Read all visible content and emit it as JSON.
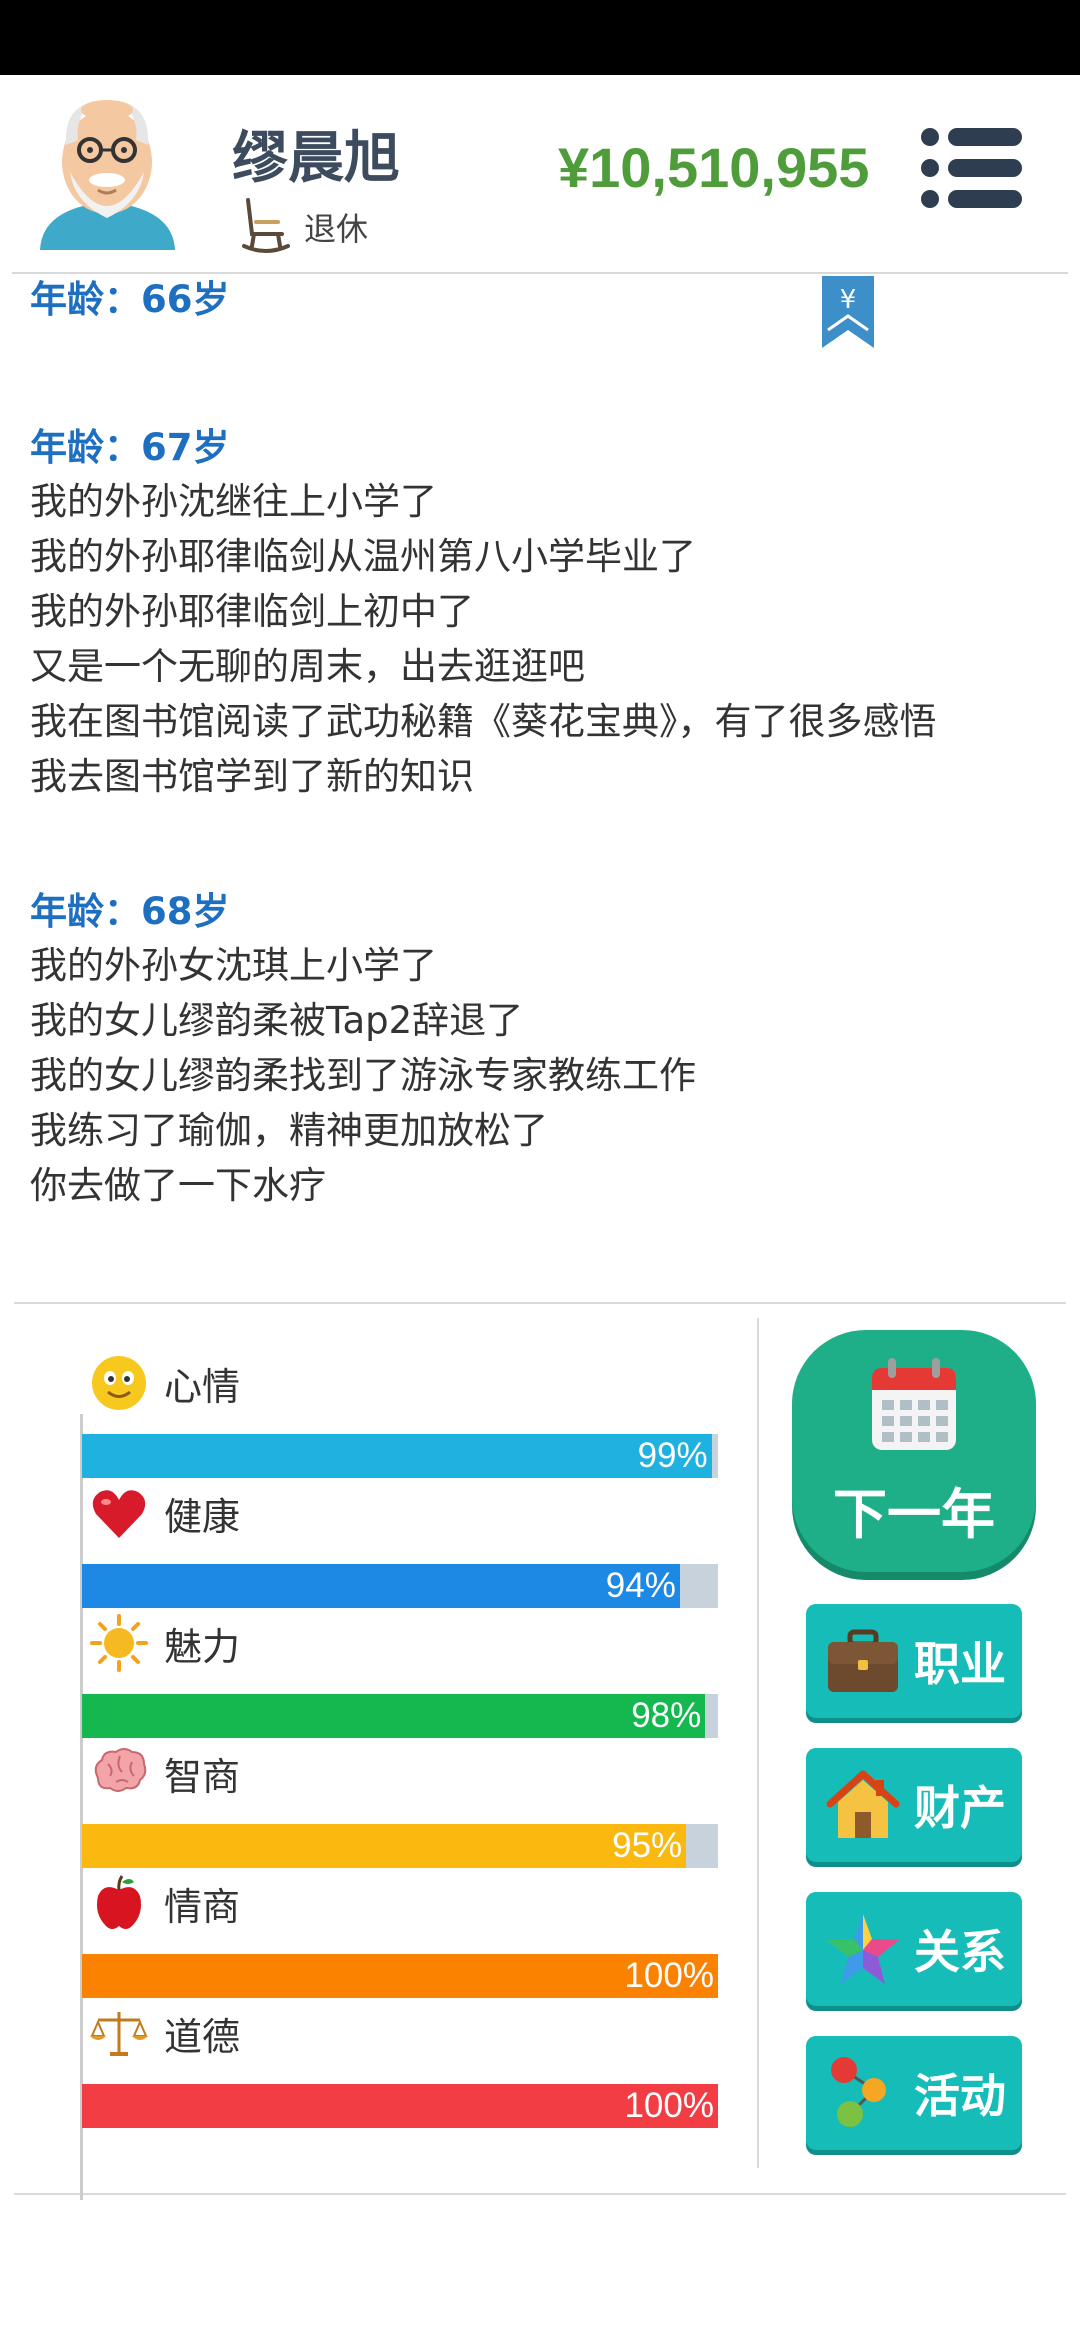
{
  "player": {
    "name": "缪晨旭",
    "status": "退休",
    "money": "¥10,510,955"
  },
  "log": [
    {
      "title": "年龄：66岁",
      "events": []
    },
    {
      "title": "年龄：67岁",
      "events": [
        "我的外孙沈继往上小学了",
        "我的外孙耶律临剑从温州第八小学毕业了",
        "我的外孙耶律临剑上初中了",
        "又是一个无聊的周末，出去逛逛吧",
        "我在图书馆阅读了武功秘籍《葵花宝典》，有了很多感悟",
        "我去图书馆学到了新的知识"
      ]
    },
    {
      "title": "年龄：68岁",
      "events": [
        "我的外孙女沈琪上小学了",
        "我的女儿缪韵柔被Tap2辞退了",
        "我的女儿缪韵柔找到了游泳专家教练工作",
        "我练习了瑜伽，精神更加放松了",
        "你去做了一下水疗"
      ]
    }
  ],
  "stats": [
    {
      "label": "心情",
      "value": 99,
      "display": "99%",
      "color": "#1fb1e0",
      "icon": "smiley-icon"
    },
    {
      "label": "健康",
      "value": 94,
      "display": "94%",
      "color": "#1e88e5",
      "icon": "heart-icon"
    },
    {
      "label": "魅力",
      "value": 98,
      "display": "98%",
      "color": "#14b84f",
      "icon": "sun-icon"
    },
    {
      "label": "智商",
      "value": 95,
      "display": "95%",
      "color": "#fbb80f",
      "icon": "brain-icon"
    },
    {
      "label": "情商",
      "value": 100,
      "display": "100%",
      "color": "#fb8200",
      "icon": "apple-icon"
    },
    {
      "label": "道德",
      "value": 100,
      "display": "100%",
      "color": "#f23d45",
      "icon": "scales-icon"
    }
  ],
  "actions": {
    "next_year": "下一年",
    "career": "职业",
    "property": "财产",
    "relations": "关系",
    "activities": "活动"
  },
  "colors": {
    "money": "#4f9d3a",
    "year_title": "#1f6fc1",
    "next_year_btn": "#1faf88",
    "side_btn": "#16bcb8"
  }
}
